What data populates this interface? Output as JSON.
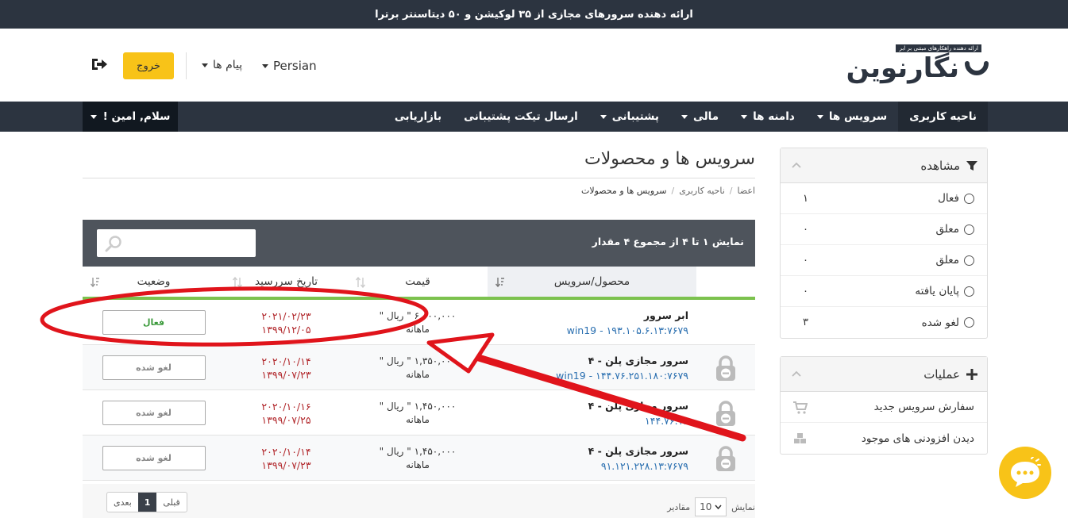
{
  "topbar": {
    "text": "ارائه دهنده سرورهای مجازی از ۳۵ لوکیشن و ۵۰ دیتاسنتر برترا"
  },
  "header": {
    "logo_text": "نگارنوین",
    "logo_tagline": "ارائه دهنده راهکارهای مبتنی بر ابر",
    "language": "Persian",
    "messages": "پیام ها",
    "logout_label": "خروج"
  },
  "nav": {
    "items": [
      {
        "label": "ناحیه کاربری",
        "dropdown": false
      },
      {
        "label": "سرویس ها",
        "dropdown": true
      },
      {
        "label": "دامنه ها",
        "dropdown": true
      },
      {
        "label": "مالی",
        "dropdown": true
      },
      {
        "label": "پشتیبانی",
        "dropdown": true
      },
      {
        "label": "ارسال تیکت پشتیبانی",
        "dropdown": false
      },
      {
        "label": "بازاریابی",
        "dropdown": false
      }
    ],
    "user_greeting": "سلام, امین !"
  },
  "sidebar": {
    "view_panel": {
      "title": "مشاهده",
      "filters": [
        {
          "label": "فعال",
          "count": "۱"
        },
        {
          "label": "معلق",
          "count": "۰"
        },
        {
          "label": "معلق",
          "count": "۰"
        },
        {
          "label": "پایان یافته",
          "count": "۰"
        },
        {
          "label": "لغو شده",
          "count": "۳"
        }
      ]
    },
    "actions_panel": {
      "title": "عملیات",
      "items": [
        {
          "label": "سفارش سرویس جدید",
          "icon": "cart-icon"
        },
        {
          "label": "دیدن افزودنی های موجود",
          "icon": "cubes-icon"
        }
      ]
    }
  },
  "main": {
    "title": "سرویس ها و محصولات",
    "breadcrumb": [
      "اعضا",
      "ناحیه کاربری",
      "سرویس ها و محصولات"
    ],
    "table_info": "نمایش ۱ تا ۴ از مجموع ۴ مقدار",
    "search_placeholder": "",
    "columns": {
      "product": "محصول/سرویس",
      "price": "قیمت",
      "due_date": "تاریخ سررسید",
      "status": "وضعیت"
    },
    "rows": [
      {
        "name": "ابر سرور",
        "host": "win19 - ۱۹۳.۱۰۵.۶.۱۳:۷۶۷۹",
        "price": "۶,۰۰۰,۰۰۰ \" ریال \"",
        "cycle": "ماهانه",
        "date_g": "۲۰۲۱/۰۲/۲۳",
        "date_j": "۱۳۹۹/۱۲/۰۵",
        "status": "فعال",
        "locked": false,
        "active": true
      },
      {
        "name": "سرور مجازی پلن - ۴",
        "host": "win19 - ۱۴۴.۷۶.۲۵۱.۱۸۰:۷۶۷۹",
        "price": "۱,۳۵۰,۰۰۰ \" ریال \"",
        "cycle": "ماهانه",
        "date_g": "۲۰۲۰/۱۰/۱۴",
        "date_j": "۱۳۹۹/۰۷/۲۳",
        "status": "لغو شده",
        "locked": true,
        "active": false
      },
      {
        "name": "سرور مجازی پلن - ۴",
        "host": "۱۴۴.۷۶.۱۵",
        "price": "۱,۴۵۰,۰۰۰ \" ریال \"",
        "cycle": "ماهانه",
        "date_g": "۲۰۲۰/۱۰/۱۶",
        "date_j": "۱۳۹۹/۰۷/۲۵",
        "status": "لغو شده",
        "locked": true,
        "active": false
      },
      {
        "name": "سرور مجازی پلن - ۴",
        "host": "۹۱.۱۲۱.۲۲۸.۱۳:۷۶۷۹",
        "price": "۱,۴۵۰,۰۰۰ \" ریال \"",
        "cycle": "ماهانه",
        "date_g": "۲۰۲۰/۱۰/۱۴",
        "date_j": "۱۳۹۹/۰۷/۲۳",
        "status": "لغو شده",
        "locked": true,
        "active": false
      }
    ],
    "footer": {
      "show_label": "نمایش",
      "entries_label": "مقادیر",
      "page_size": "10",
      "prev": "قبلی",
      "current_page": "1",
      "next": "بعدی"
    }
  },
  "colors": {
    "dark": "#2c3440",
    "accent": "#f8c318",
    "green": "#7cc24e",
    "red_annotation": "#e0141b"
  }
}
